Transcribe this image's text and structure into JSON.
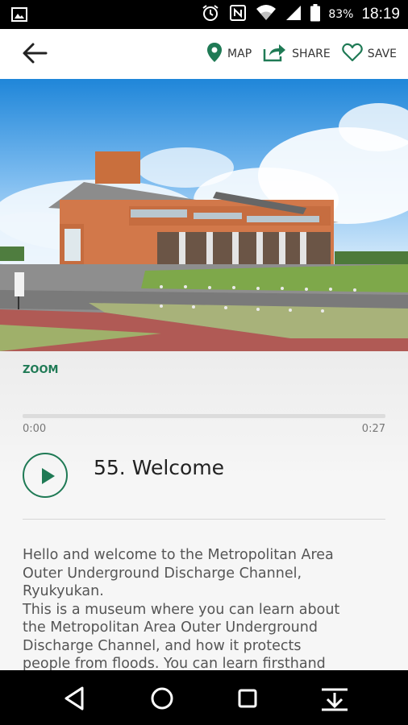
{
  "status_bar": {
    "battery_percent": "83%",
    "time": "18:19",
    "icons": [
      "image-icon",
      "alarm-icon",
      "nfc-icon",
      "wifi-icon",
      "signal-icon",
      "battery-icon"
    ]
  },
  "toolbar": {
    "back_icon": "arrow-left-icon",
    "map_label": "MAP",
    "share_label": "SHARE",
    "save_label": "SAVE",
    "accent_color": "#1f7a55"
  },
  "hero": {
    "description": "museum-building-photo"
  },
  "zoom_label": "ZOOM",
  "player": {
    "elapsed": "0:00",
    "duration": "0:27",
    "progress": 0,
    "title": "55. Welcome"
  },
  "description": "Hello and welcome to the Metropolitan Area\nOuter Underground Discharge Channel,\nRyukyukan.\nThis is a museum where you can learn about\nthe Metropolitan Area Outer Underground\nDischarge Channel, and how it protects\npeople from floods. You can learn firsthand",
  "nav_bar": {
    "icons": [
      "back-triangle-icon",
      "home-circle-icon",
      "recents-square-icon",
      "keyboard-hide-icon"
    ]
  }
}
